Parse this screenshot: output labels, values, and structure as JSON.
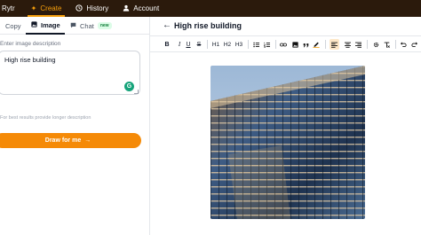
{
  "nav": {
    "brand": "Rytr",
    "items": [
      {
        "label": "Create",
        "icon": "sparkle-icon",
        "active": true
      },
      {
        "label": "History",
        "icon": "clock-icon"
      },
      {
        "label": "Account",
        "icon": "user-icon"
      }
    ]
  },
  "left_panel": {
    "tabs": [
      {
        "label": "Copy"
      },
      {
        "label": "Image",
        "active": true
      },
      {
        "label": "Chat",
        "badge": "new"
      }
    ],
    "field_label": "Enter image description",
    "textarea_value": "High rise building",
    "hint": "For best results provide longer description",
    "draw_button": "Draw for me",
    "draw_button_arrow": "→",
    "grammarly_letter": "G"
  },
  "editor": {
    "back_icon": "←",
    "title": "High rise building",
    "toolbar": {
      "bold": "B",
      "italic": "I",
      "underline": "U",
      "strike": "S",
      "h1": "H1",
      "h2": "H2",
      "h3": "H3"
    }
  },
  "colors": {
    "topbar": "#2b1a0c",
    "accent": "#f58a07",
    "active_nav": "#f59e0b"
  }
}
